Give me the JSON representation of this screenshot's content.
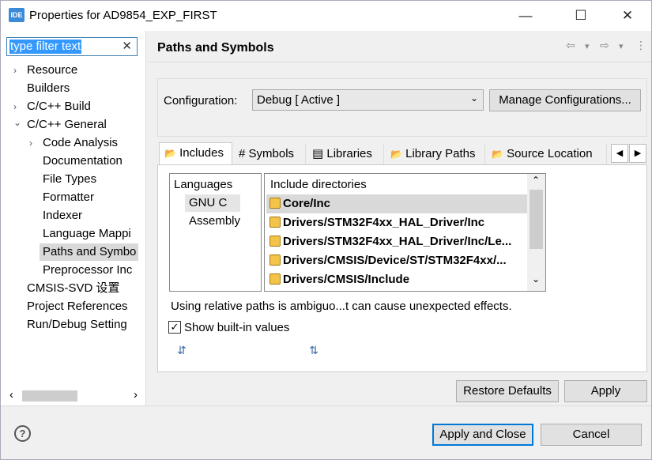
{
  "window": {
    "app_icon": "IDE",
    "title": "Properties for AD9854_EXP_FIRST",
    "minimize": "—",
    "maximize": "☐",
    "close": "✕"
  },
  "filter": {
    "value": "type filter text",
    "clear": "✕"
  },
  "tree": [
    {
      "label": "Resource",
      "twisty": "›"
    },
    {
      "label": "Builders",
      "twisty": ""
    },
    {
      "label": "C/C++ Build",
      "twisty": "›"
    },
    {
      "label": "C/C++ General",
      "twisty": "⌄"
    },
    {
      "label": "Code Analysis",
      "twisty": "›"
    },
    {
      "label": "Documentation",
      "twisty": ""
    },
    {
      "label": "File Types",
      "twisty": ""
    },
    {
      "label": "Formatter",
      "twisty": ""
    },
    {
      "label": "Indexer",
      "twisty": ""
    },
    {
      "label": "Language Mappi",
      "twisty": ""
    },
    {
      "label": "Paths and Symbo",
      "twisty": ""
    },
    {
      "label": "Preprocessor Inc",
      "twisty": ""
    },
    {
      "label": "CMSIS-SVD 设置",
      "twisty": ""
    },
    {
      "label": "Project References",
      "twisty": ""
    },
    {
      "label": "Run/Debug Setting",
      "twisty": ""
    }
  ],
  "hscroll": {
    "left": "‹",
    "right": "›"
  },
  "page": {
    "title": "Paths and Symbols",
    "nav": [
      "⇦",
      "▾",
      "⇨",
      "▾",
      "⋮"
    ]
  },
  "config": {
    "label": "Configuration:",
    "value": "Debug  [ Active ]",
    "arrow": "⌄",
    "manage": "Manage Configurations..."
  },
  "tabs": [
    {
      "label": "Includes",
      "icon": "📂"
    },
    {
      "label": "Symbols",
      "icon": "#"
    },
    {
      "label": "Libraries",
      "icon": "▤"
    },
    {
      "label": "Library Paths",
      "icon": "📂"
    },
    {
      "label": "Source Location",
      "icon": "📂"
    }
  ],
  "tab_scroll": {
    "left": "◀",
    "right": "▶"
  },
  "languages": {
    "header": "Languages",
    "items": [
      "GNU C",
      "Assembly"
    ]
  },
  "includes": {
    "header": "Include directories",
    "items": [
      "Core/Inc",
      "Drivers/STM32F4xx_HAL_Driver/Inc",
      "Drivers/STM32F4xx_HAL_Driver/Inc/Le...",
      "Drivers/CMSIS/Device/ST/STM32F4xx/...",
      "Drivers/CMSIS/Include"
    ],
    "up": "⌃",
    "down": "⌄"
  },
  "note": "Using relative paths is ambiguo...t can cause unexpected effects.",
  "show_builtin": {
    "label": "Show built-in values",
    "checked": "✓"
  },
  "tools": [
    "⇵",
    "⇅"
  ],
  "buttons": {
    "restore": "Restore Defaults",
    "apply": "Apply",
    "apply_close": "Apply and Close",
    "cancel": "Cancel",
    "help": "?"
  }
}
